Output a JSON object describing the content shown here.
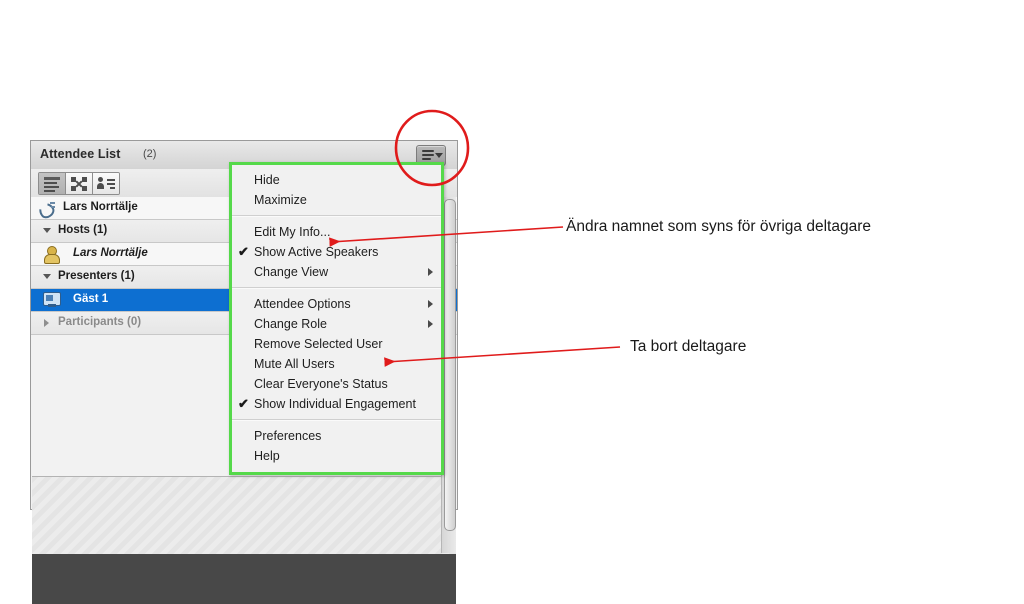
{
  "panel": {
    "title": "Attendee List",
    "count": "(2)",
    "menu_button_icon": "hamburger-dropdown-icon",
    "toolbar": [
      {
        "name": "list-view-button",
        "icon": "list-view-icon",
        "active": true
      },
      {
        "name": "grid-view-button",
        "icon": "expand-grid-icon",
        "active": false
      },
      {
        "name": "name-sort-button",
        "icon": "person-list-icon",
        "active": false
      }
    ],
    "rows": [
      {
        "label": "Lars Norrtälje",
        "icon": "phone-icon",
        "type": "phone"
      },
      {
        "label": "Hosts (1)",
        "type": "group",
        "expanded": true
      },
      {
        "label": "Lars Norrtälje",
        "icon": "host-icon",
        "type": "host",
        "italic": true
      },
      {
        "label": "Presenters (1)",
        "type": "group",
        "expanded": true
      },
      {
        "label": "Gäst 1",
        "icon": "presenter-screen-icon",
        "type": "presenter",
        "selected": true
      },
      {
        "label": "Participants (0)",
        "type": "group",
        "expanded": false,
        "dim": true
      }
    ]
  },
  "context_menu": {
    "border_color": "#55d94a",
    "items": [
      {
        "label": "Hide",
        "name": "menu-item-hide"
      },
      {
        "label": "Maximize",
        "name": "menu-item-maximize"
      },
      {
        "separator": true
      },
      {
        "label": "Edit My Info...",
        "name": "menu-item-edit-my-info"
      },
      {
        "label": "Show Active Speakers",
        "name": "menu-item-show-active-speakers",
        "checked": true
      },
      {
        "label": "Change View",
        "name": "menu-item-change-view",
        "submenu": true
      },
      {
        "separator": true
      },
      {
        "label": "Attendee Options",
        "name": "menu-item-attendee-options",
        "submenu": true
      },
      {
        "label": "Change Role",
        "name": "menu-item-change-role",
        "submenu": true
      },
      {
        "label": "Remove Selected User",
        "name": "menu-item-remove-selected-user"
      },
      {
        "label": "Mute All Users",
        "name": "menu-item-mute-all-users"
      },
      {
        "label": "Clear Everyone's Status",
        "name": "menu-item-clear-everyones-status"
      },
      {
        "label": "Show Individual Engagement",
        "name": "menu-item-show-individual-engagement",
        "checked": true
      },
      {
        "separator": true
      },
      {
        "label": "Preferences",
        "name": "menu-item-preferences"
      },
      {
        "label": "Help",
        "name": "menu-item-help"
      }
    ],
    "check_glyph": "✔"
  },
  "annotations": {
    "color": "#e01b1b",
    "note_1": "Ändra namnet som syns för övriga deltagare",
    "note_2": "Ta bort deltagare"
  }
}
